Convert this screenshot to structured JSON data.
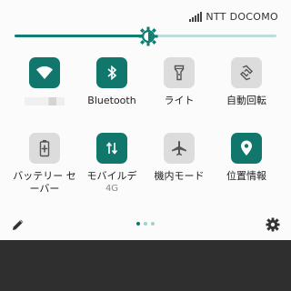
{
  "status": {
    "carrier": "NTT DOCOMO",
    "signal_icon": "signal-icon"
  },
  "brightness": {
    "level_fraction": 0.51,
    "thumb_icon": "brightness-sun-icon"
  },
  "colors": {
    "accent": "#11776d",
    "inactive": "#dcdcdc",
    "bottom_bg": "#2f2f2f"
  },
  "tiles": [
    {
      "key": "wifi",
      "label": "",
      "icon": "wifi-icon",
      "active": true
    },
    {
      "key": "bluetooth",
      "label": "Bluetooth",
      "icon": "bluetooth-icon",
      "active": true
    },
    {
      "key": "flashlight",
      "label": "ライト",
      "icon": "flashlight-icon",
      "active": false
    },
    {
      "key": "autorotate",
      "label": "自動回転",
      "icon": "auto-rotate-icon",
      "active": false
    },
    {
      "key": "battery-saver",
      "label": "バッテリー セーバー",
      "icon": "battery-saver-icon",
      "active": false
    },
    {
      "key": "mobile-data",
      "label": "モバイルデ",
      "sublabel": "4G",
      "icon": "mobile-data-icon",
      "active": true
    },
    {
      "key": "airplane",
      "label": "機内モード",
      "icon": "airplane-icon",
      "active": false
    },
    {
      "key": "location",
      "label": "位置情報",
      "icon": "location-icon",
      "active": true
    }
  ],
  "footer": {
    "edit_icon": "pencil-icon",
    "settings_icon": "gear-icon",
    "page_count": 3,
    "current_page": 1
  }
}
